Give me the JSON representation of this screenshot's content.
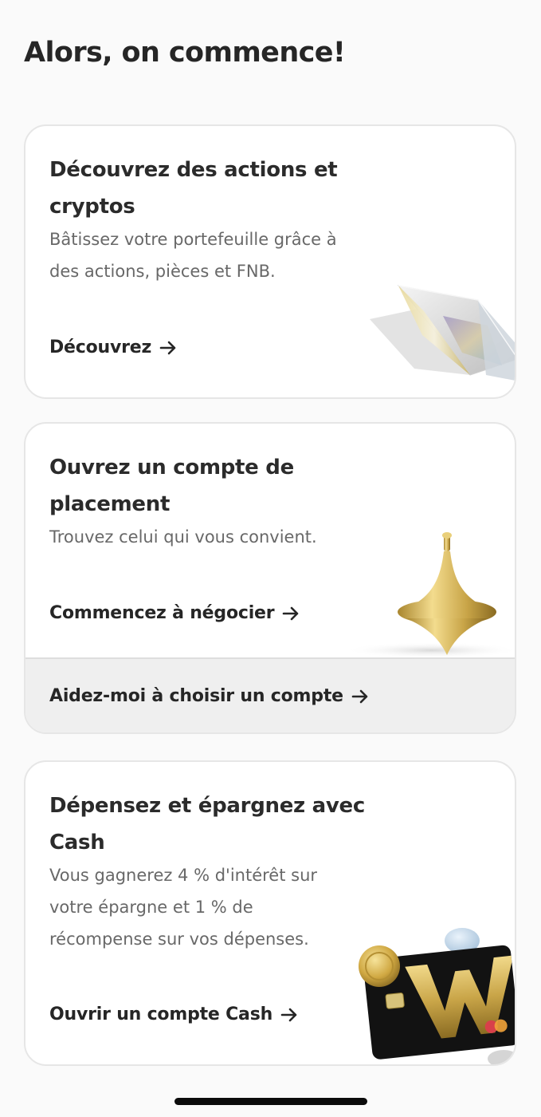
{
  "page": {
    "title": "Alors, on commence!"
  },
  "cards": [
    {
      "title": "Découvrez des actions et cryptos",
      "description": "Bâtissez votre portefeuille grâce à des actions, pièces et FNB.",
      "cta": "Découvrez",
      "illustration": "crystal-prism"
    },
    {
      "title": "Ouvrez un compte de placement",
      "description": "Trouvez celui qui vous convient.",
      "cta": "Commencez à négocier",
      "secondary_cta": "Aidez-moi à choisir un compte",
      "illustration": "gold-spinning-top"
    },
    {
      "title": "Dépensez et épargnez avec Cash",
      "description": "Vous gagnerez 4 % d'intérêt sur votre épargne et 1 % de récompense sur vos dépenses.",
      "cta": "Ouvrir un compte Cash",
      "illustration": "black-card-with-coins",
      "card_letter": "W"
    }
  ],
  "icons": {
    "cta_arrow": "arrow-right-icon"
  },
  "colors": {
    "background": "#fafafa",
    "card": "#ffffff",
    "card_border": "#e6e6e6",
    "text_primary": "#262626",
    "text_secondary": "#686868",
    "secondary_band": "#efefef",
    "gold": "#c9a548"
  }
}
